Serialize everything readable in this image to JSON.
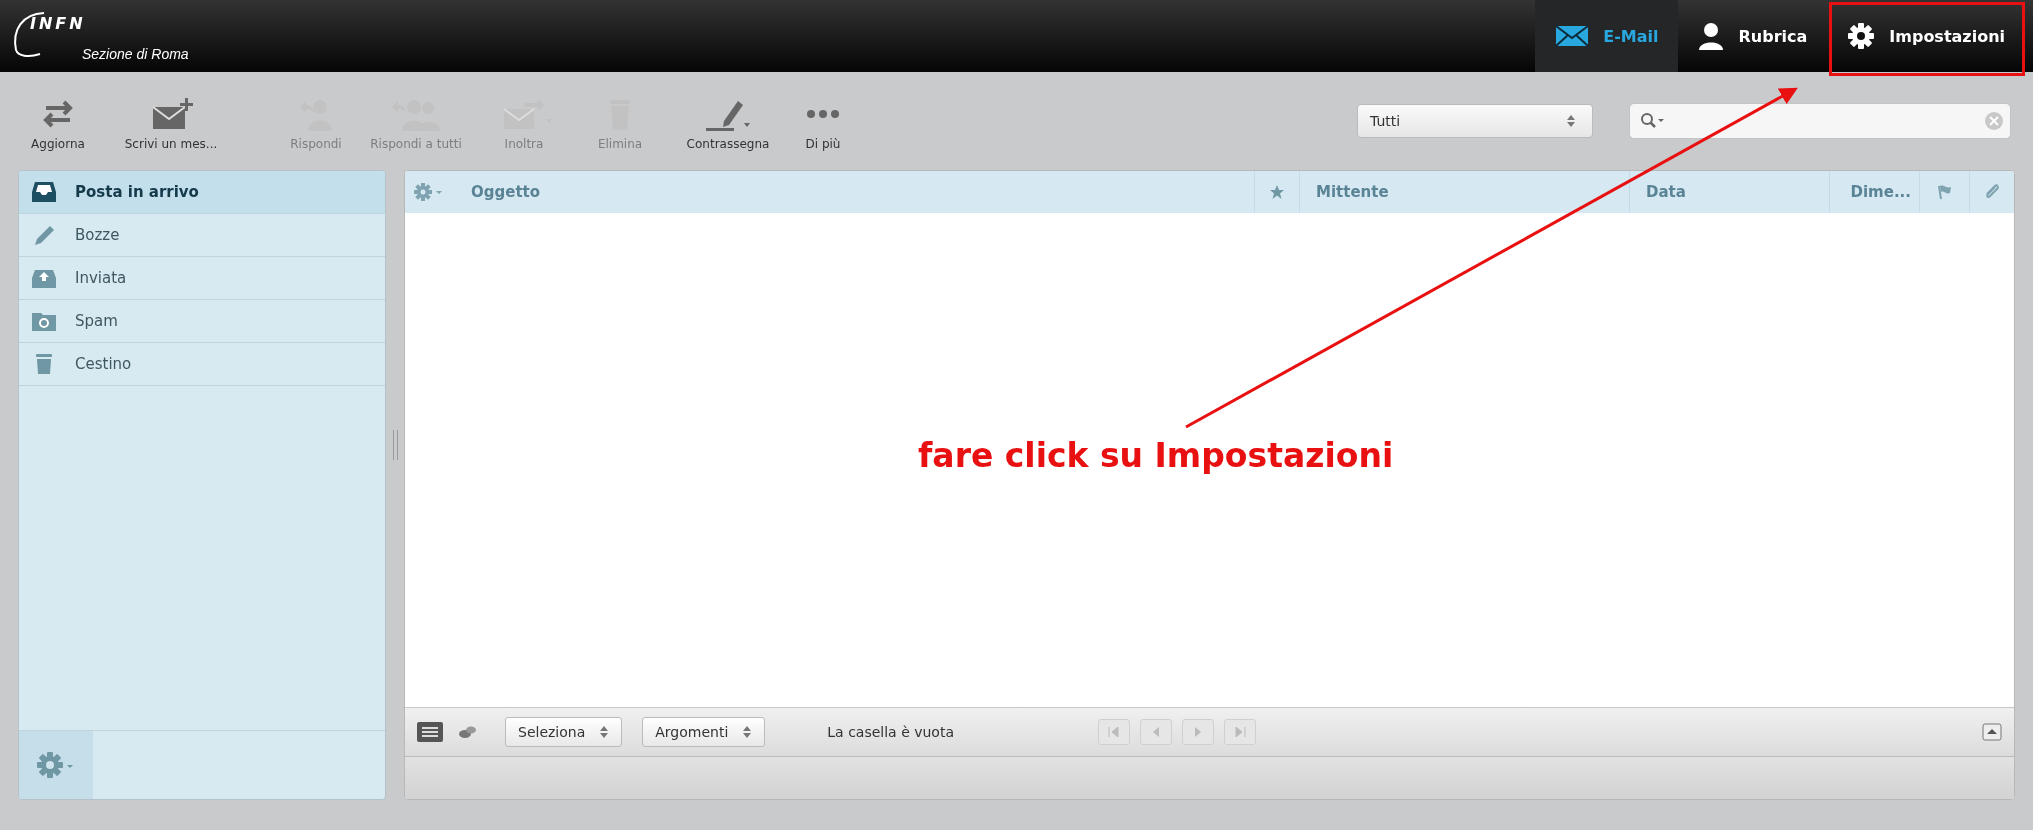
{
  "logo": {
    "text": "INFN",
    "subtitle": "Sezione di Roma"
  },
  "nav": [
    {
      "label": "E-Mail",
      "selected": true,
      "highlighted": false
    },
    {
      "label": "Rubrica",
      "selected": false,
      "highlighted": false
    },
    {
      "label": "Impostazioni",
      "selected": false,
      "highlighted": true
    }
  ],
  "toolbar": [
    {
      "label": "Aggiorna",
      "disabled": false
    },
    {
      "label": "Scrivi un mes...",
      "disabled": false
    },
    {
      "label": "Rispondi",
      "disabled": true
    },
    {
      "label": "Rispondi a tutti",
      "disabled": true
    },
    {
      "label": "Inoltra",
      "disabled": true
    },
    {
      "label": "Elimina",
      "disabled": true
    },
    {
      "label": "Contrassegna",
      "disabled": false
    },
    {
      "label": "Di più",
      "disabled": false
    }
  ],
  "filter": {
    "value": "Tutti"
  },
  "sidebar": {
    "folders": [
      {
        "label": "Posta in arrivo",
        "selected": true
      },
      {
        "label": "Bozze",
        "selected": false
      },
      {
        "label": "Inviata",
        "selected": false
      },
      {
        "label": "Spam",
        "selected": false
      },
      {
        "label": "Cestino",
        "selected": false
      }
    ]
  },
  "table": {
    "columns": [
      "Oggetto",
      "Mittente",
      "Data",
      "Dime..."
    ]
  },
  "bottom_bar": {
    "selects": [
      "Seleziona",
      "Argomenti"
    ],
    "status": "La casella è vuota"
  },
  "annotation": {
    "text": "fare click su Impostazioni"
  }
}
